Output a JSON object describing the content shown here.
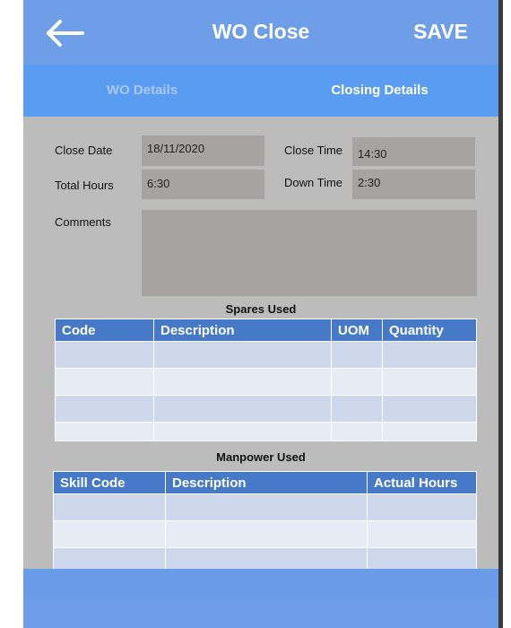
{
  "header": {
    "back_icon": "arrow-left-icon",
    "title": "WO Close",
    "save_label": "SAVE"
  },
  "tabs": [
    {
      "label": "WO Details",
      "active": false
    },
    {
      "label": "Closing Details",
      "active": true
    }
  ],
  "form": {
    "close_date": {
      "label": "Close Date",
      "value": "18/11/2020"
    },
    "close_time": {
      "label": "Close Time",
      "value": "14:30"
    },
    "total_hours": {
      "label": "Total Hours",
      "value": "6:30"
    },
    "down_time": {
      "label": "Down Time",
      "value": "2:30"
    },
    "comments": {
      "label": "Comments",
      "value": ""
    }
  },
  "spares": {
    "title": "Spares Used",
    "columns": [
      "Code",
      "Description",
      "UOM",
      "Quantity"
    ],
    "rows": [
      [
        "",
        "",
        "",
        ""
      ],
      [
        "",
        "",
        "",
        ""
      ],
      [
        "",
        "",
        "",
        ""
      ],
      [
        "",
        "",
        "",
        ""
      ]
    ]
  },
  "manpower": {
    "title": "Manpower Used",
    "columns": [
      "Skill Code",
      "Description",
      "Actual Hours"
    ],
    "rows": [
      [
        "",
        "",
        ""
      ],
      [
        "",
        "",
        ""
      ],
      [
        "",
        "",
        ""
      ]
    ]
  },
  "colors": {
    "header_bg": "#6f9ee8",
    "tab_bg": "#5b9cf3",
    "table_header_bg": "#4779c9",
    "field_bg": "#a8a3a3",
    "page_bg": "#bcbcbc"
  }
}
